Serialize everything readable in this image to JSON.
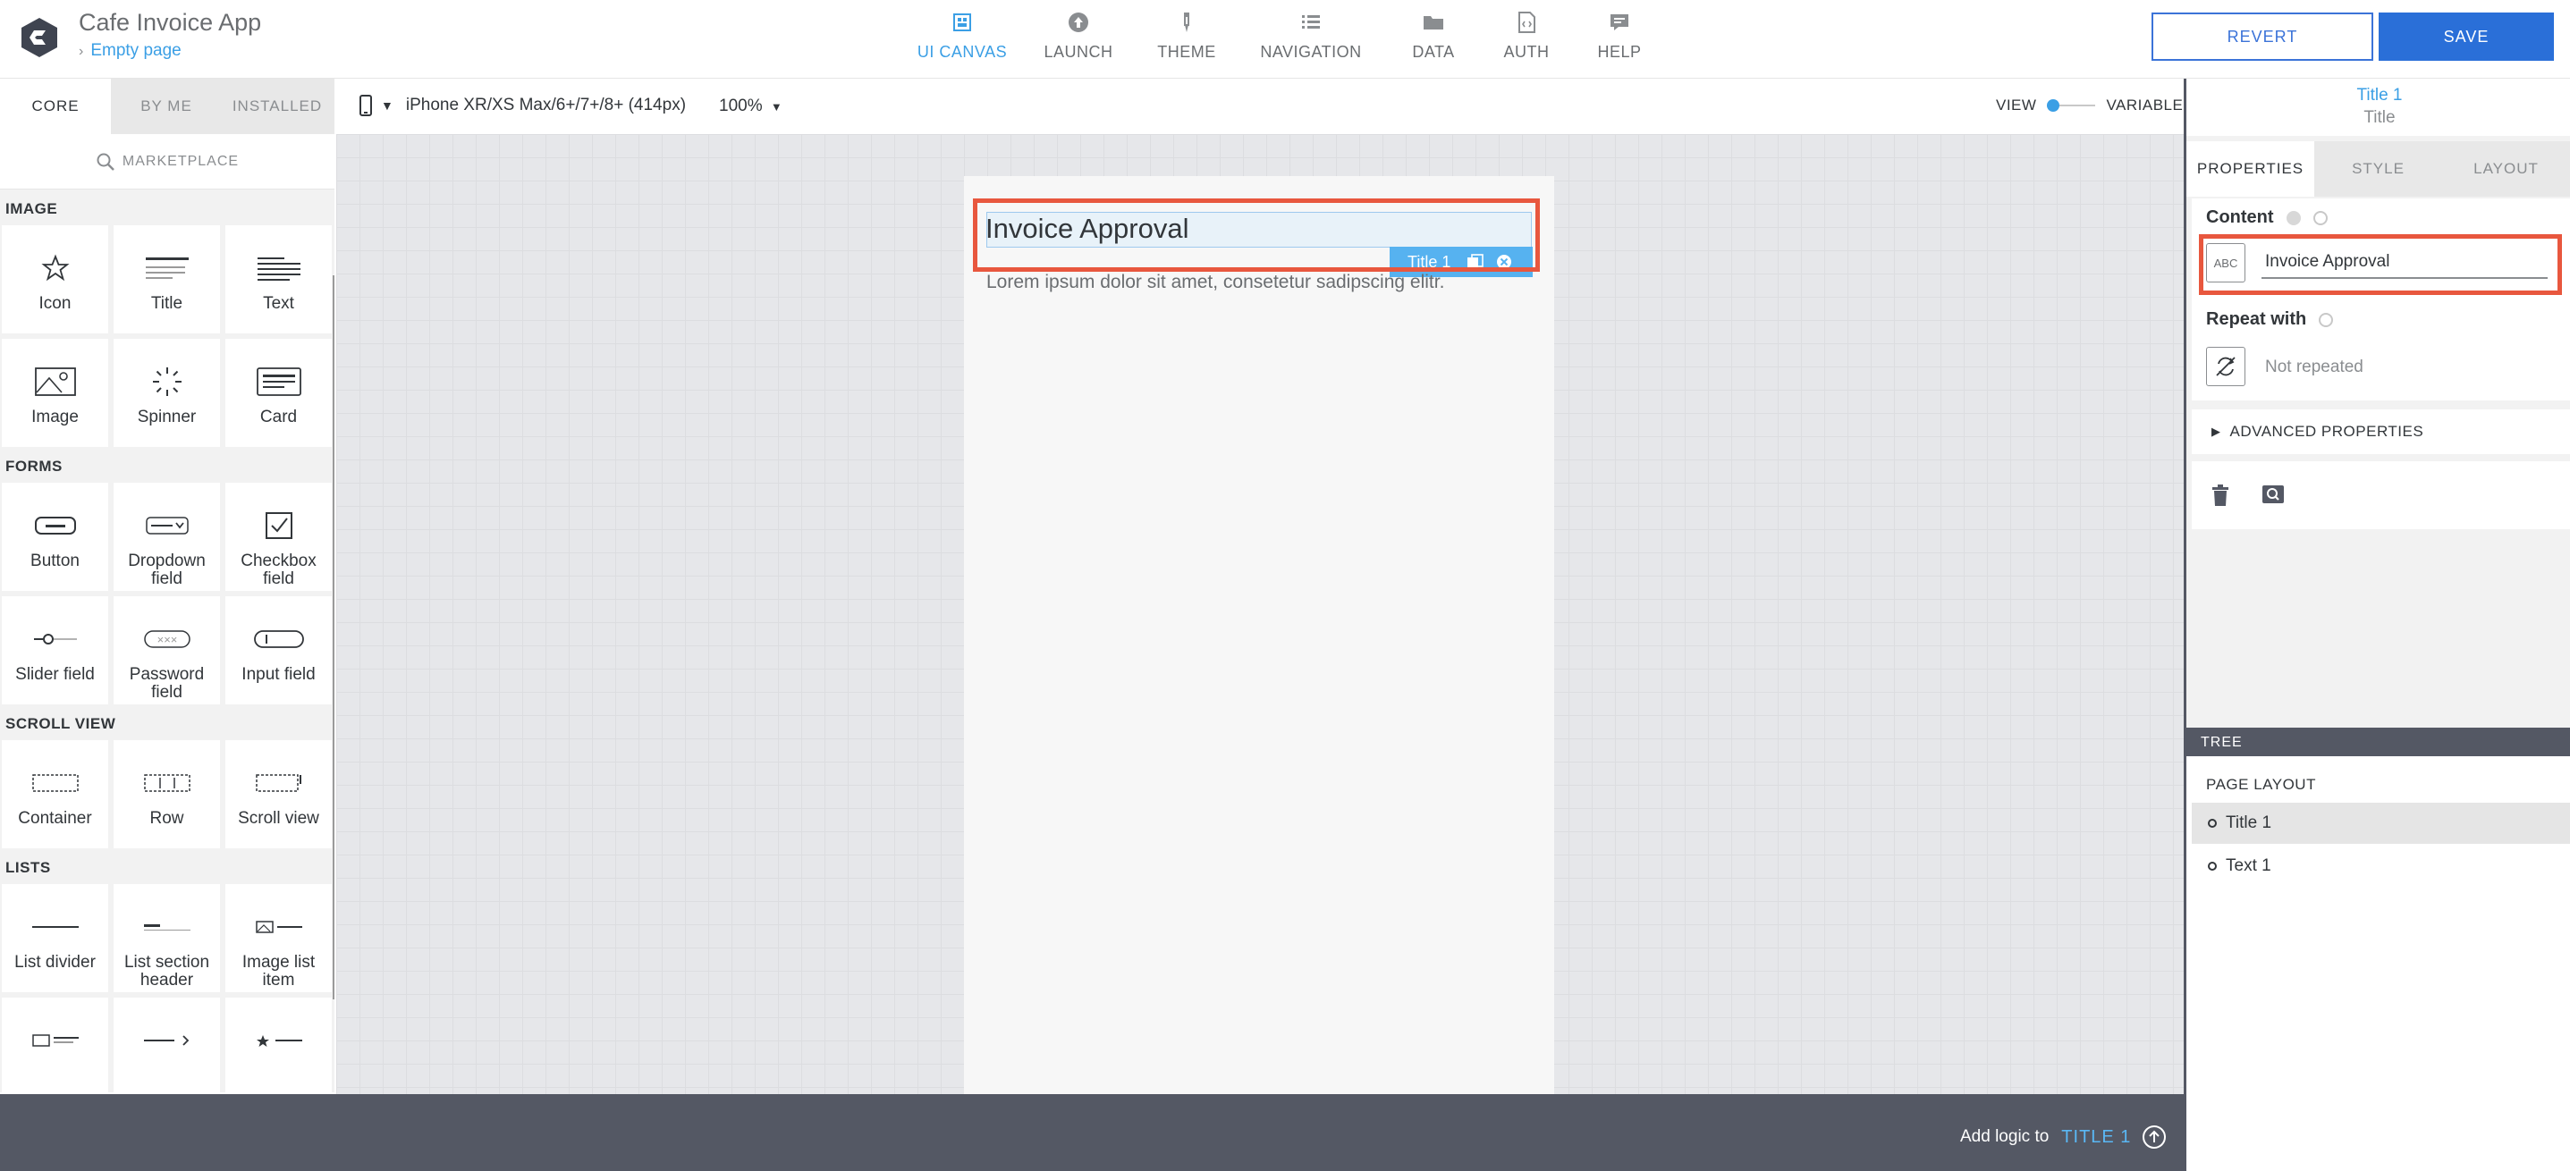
{
  "app": {
    "title": "Cafe Invoice App",
    "page": "Empty page"
  },
  "topnav": [
    {
      "label": "UI CANVAS",
      "icon": "ui-canvas-icon",
      "active": true
    },
    {
      "label": "LAUNCH",
      "icon": "launch-icon",
      "active": false
    },
    {
      "label": "THEME",
      "icon": "theme-icon",
      "active": false
    },
    {
      "label": "NAVIGATION",
      "icon": "navigation-icon",
      "active": false
    },
    {
      "label": "DATA",
      "icon": "data-icon",
      "active": false
    },
    {
      "label": "AUTH",
      "icon": "auth-icon",
      "active": false
    },
    {
      "label": "HELP",
      "icon": "help-icon",
      "active": false
    }
  ],
  "actions": {
    "revert": "REVERT",
    "save": "SAVE"
  },
  "palette": {
    "tabs": [
      "CORE",
      "BY ME",
      "INSTALLED"
    ],
    "marketplace": "MARKETPLACE",
    "sections": [
      {
        "title": "IMAGE",
        "items": [
          "Icon",
          "Title",
          "Text",
          "Image",
          "Spinner",
          "Card"
        ]
      },
      {
        "title": "FORMS",
        "items": [
          "Button",
          "Dropdown field",
          "Checkbox field",
          "Slider field",
          "Password field",
          "Input field"
        ]
      },
      {
        "title": "SCROLL VIEW",
        "items": [
          "Container",
          "Row",
          "Scroll view"
        ]
      },
      {
        "title": "LISTS",
        "items": [
          "List divider",
          "List section header",
          "Image list item"
        ]
      }
    ]
  },
  "toolbar": {
    "device": "iPhone XR/XS Max/6+/7+/8+ (414px)",
    "zoom": "100%",
    "view": "VIEW",
    "variables": "VARIABLES"
  },
  "canvas": {
    "title_text": "Invoice Approval",
    "selection_tag": "Title 1",
    "body_text": "Lorem ipsum dolor sit amet, consetetur sadipscing elitr."
  },
  "logic": {
    "prefix": "Add logic to",
    "target": "TITLE 1"
  },
  "inspector": {
    "selected_name": "Title 1",
    "selected_type": "Title",
    "tabs": [
      "PROPERTIES",
      "STYLE",
      "LAYOUT"
    ],
    "content_label": "Content",
    "content_value": "Invoice Approval",
    "abc_glyph": "ABC",
    "repeat_label": "Repeat with",
    "repeat_value": "Not repeated",
    "advanced": "ADVANCED PROPERTIES"
  },
  "tree": {
    "header": "TREE",
    "page_layout": "PAGE LAYOUT",
    "nodes": [
      {
        "label": "Title 1",
        "selected": true
      },
      {
        "label": "Text 1",
        "selected": false
      }
    ]
  },
  "colors": {
    "accent": "#3b9fe5",
    "save": "#2a6fd8",
    "highlight": "#e8573e",
    "dark_bar": "#545864"
  }
}
